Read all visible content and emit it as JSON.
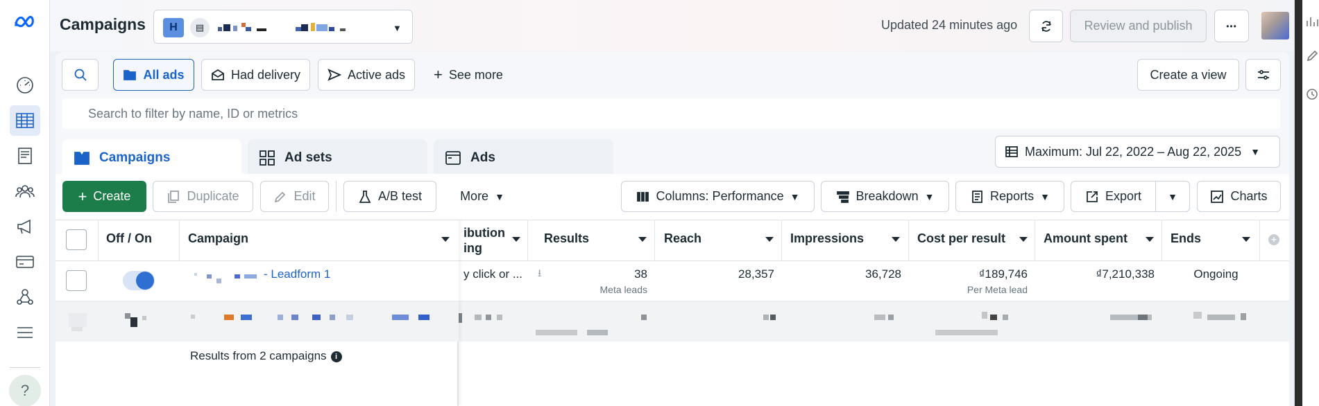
{
  "header": {
    "title": "Campaigns",
    "account_initial": "H",
    "updated": "Updated 24 minutes ago",
    "review_publish": "Review and publish",
    "more_dots": "•••"
  },
  "filters": {
    "all_ads": "All ads",
    "had_delivery": "Had delivery",
    "active_ads": "Active ads",
    "see_more": "See more",
    "create_view": "Create a view",
    "search_placeholder": "Search to filter by name, ID or metrics"
  },
  "tabs": {
    "campaigns": "Campaigns",
    "ad_sets": "Ad sets",
    "ads": "Ads",
    "date_range": "Maximum: Jul 22, 2022 – Aug 22, 2025"
  },
  "toolbar": {
    "create": "Create",
    "duplicate": "Duplicate",
    "edit": "Edit",
    "ab_test": "A/B test",
    "more": "More",
    "columns": "Columns: Performance",
    "breakdown": "Breakdown",
    "reports": "Reports",
    "export": "Export",
    "charts": "Charts"
  },
  "table": {
    "headers": {
      "off_on": "Off / On",
      "campaign": "Campaign",
      "attribution_1": "ibution",
      "attribution_2": "ing",
      "results": "Results",
      "reach": "Reach",
      "impressions": "Impressions",
      "cost_per_result": "Cost per result",
      "amount_spent": "Amount spent",
      "ends": "Ends"
    },
    "row1": {
      "campaign_name": "- Leadform 1",
      "attribution": "y click or ...",
      "results": "38",
      "results_sub": "Meta leads",
      "reach": "28,357",
      "impressions": "36,728",
      "cost_per_result": "₫189,746",
      "cost_sub": "Per Meta lead",
      "amount_spent": "₫7,210,338",
      "ends": "Ongoing"
    },
    "summary": "Results from 2 campaigns"
  },
  "colors": {
    "accent": "#1a63c8",
    "create_green": "#1c7d4a"
  }
}
